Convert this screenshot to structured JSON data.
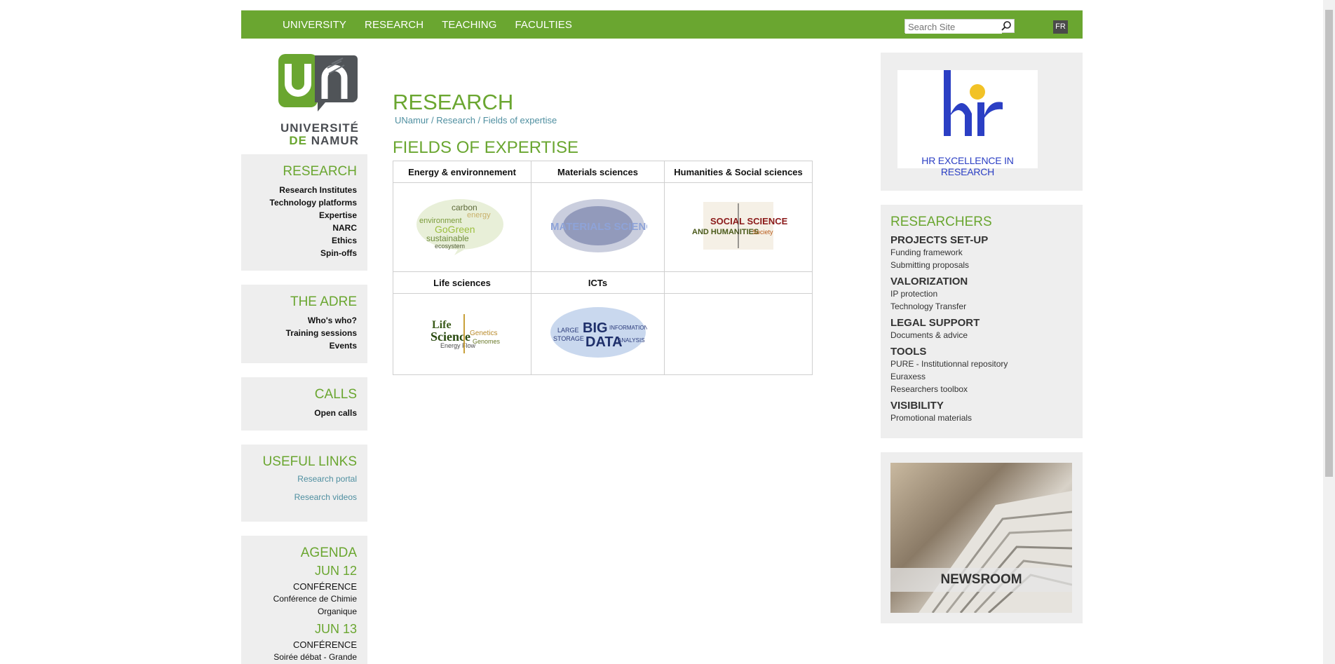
{
  "nav": {
    "items": [
      "UNIVERSITY",
      "RESEARCH",
      "TEACHING",
      "FACULTIES"
    ],
    "search_placeholder": "Search Site",
    "lang": "FR"
  },
  "logo": {
    "line1": "UNIVERSITÉ",
    "line2a": "DE",
    "line2b": "NAMUR"
  },
  "sidebar": {
    "research": {
      "title": "RESEARCH",
      "links": [
        "Research Institutes",
        "Technology platforms",
        "Expertise",
        "NARC",
        "Ethics",
        "Spin-offs"
      ]
    },
    "adre": {
      "title": "THE ADRE",
      "links": [
        "Who's who?",
        "Training sessions",
        "Events"
      ]
    },
    "calls": {
      "title": "CALLS",
      "links": [
        "Open calls"
      ]
    },
    "useful": {
      "title": "USEFUL LINKS",
      "links": [
        "Research portal",
        "Research videos"
      ]
    },
    "agenda": {
      "title": "AGENDA",
      "events": [
        {
          "date": "JUN 12",
          "type": "CONFÉRENCE",
          "title1": "Conférence de Chimie",
          "title2": "Organique"
        },
        {
          "date": "JUN 13",
          "type": "CONFÉRENCE",
          "title1": "Soirée débat - Grande",
          "title2": ""
        }
      ]
    }
  },
  "main": {
    "title": "RESEARCH",
    "breadcrumb": [
      "UNamur",
      "Research",
      "Fields of expertise"
    ],
    "sep": "/",
    "heading": "FIELDS OF EXPERTISE",
    "fields": [
      {
        "label": "Energy & environnement",
        "words": [
          "carbon",
          "environment",
          "GoGreen",
          "sustainable",
          "ecosystem",
          "energy"
        ]
      },
      {
        "label": "Materials sciences",
        "words": [
          "MATERIALS SCIENCE"
        ]
      },
      {
        "label": "Humanities & Social sciences",
        "words": [
          "SOCIAL SCIENCES",
          "AND HUMANITIES",
          "Society"
        ]
      },
      {
        "label": "Life sciences",
        "words": [
          "Life",
          "Science",
          "Genetics",
          "Energy Flow",
          "Genomes"
        ]
      },
      {
        "label": "ICTs",
        "words": [
          "BIG",
          "DATA",
          "LARGE",
          "STORAGE",
          "INFORMATION",
          "ANALYSIS"
        ]
      }
    ]
  },
  "right": {
    "hr": {
      "text": "HR EXCELLENCE IN RESEARCH"
    },
    "researchers": {
      "title": "RESEARCHERS",
      "sections": [
        {
          "heading": "PROJECTS SET-UP",
          "items": [
            "Funding framework",
            "Submitting proposals"
          ]
        },
        {
          "heading": "VALORIZATION",
          "items": [
            "IP protection",
            "Technology Transfer"
          ]
        },
        {
          "heading": "LEGAL SUPPORT",
          "items": [
            "Documents & advice"
          ]
        },
        {
          "heading": "TOOLS",
          "items": [
            "PURE - Institutionnal repository",
            "Euraxess",
            "Researchers toolbox"
          ]
        },
        {
          "heading": "VISIBILITY",
          "items": [
            "Promotional materials"
          ]
        }
      ]
    },
    "newsroom": {
      "label": "NEWSROOM"
    }
  },
  "colors": {
    "accent": "#6aa630",
    "link": "#4f8fa0",
    "panel": "#eeeeee"
  }
}
